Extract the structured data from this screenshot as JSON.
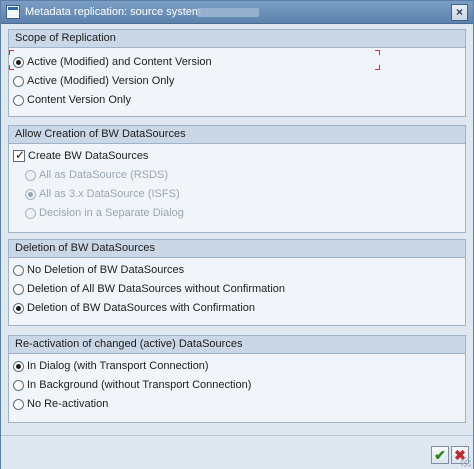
{
  "window": {
    "title": "Metadata replication: source system",
    "close_symbol": "×"
  },
  "groups": [
    {
      "title": "Scope of Replication",
      "options": [
        {
          "label": "Active (Modified) and Content Version",
          "selected": true
        },
        {
          "label": "Active (Modified) Version Only",
          "selected": false
        },
        {
          "label": "Content Version Only",
          "selected": false
        }
      ]
    },
    {
      "title": "Allow Creation of BW DataSources",
      "checkbox": {
        "label": "Create BW DataSources",
        "checked": true
      },
      "options": [
        {
          "label": "All as DataSource (RSDS)",
          "selected": false,
          "disabled": true
        },
        {
          "label": "All as 3.x DataSource (ISFS)",
          "selected": true,
          "disabled": true
        },
        {
          "label": "Decision in a Separate Dialog",
          "selected": false,
          "disabled": true
        }
      ]
    },
    {
      "title": "Deletion of BW DataSources",
      "options": [
        {
          "label": "No Deletion of BW DataSources",
          "selected": false
        },
        {
          "label": "Deletion of All BW DataSources without Confirmation",
          "selected": false
        },
        {
          "label": "Deletion of BW DataSources with Confirmation",
          "selected": true
        }
      ]
    },
    {
      "title": "Re-activation of changed (active) DataSources",
      "options": [
        {
          "label": "In Dialog (with Transport Connection)",
          "selected": true
        },
        {
          "label": "In Background (without Transport Connection)",
          "selected": false
        },
        {
          "label": "No Re-activation",
          "selected": false
        }
      ]
    }
  ],
  "footer": {
    "ok_symbol": "✔",
    "cancel_symbol": "✖"
  },
  "colors": {
    "title_bar": "#5c82ad",
    "panel": "#dfe8f1",
    "group_header": "#c9d7e6",
    "focus": "#cc3333",
    "ok": "#2a8a1e",
    "cancel": "#c0282d"
  }
}
